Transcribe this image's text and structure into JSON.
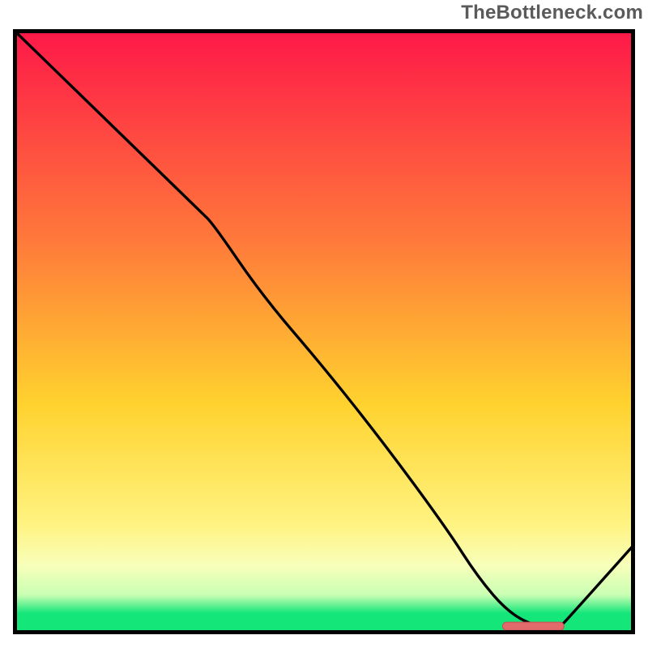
{
  "attribution": "TheBottleneck.com",
  "colors": {
    "frame": "#020202",
    "curve": "#020202",
    "marker_fill": "#e26a6a",
    "marker_stroke": "#c94f4f",
    "top": "#fe1948",
    "mid1": "#ff7a3a",
    "mid2": "#ffd22e",
    "low1": "#fff380",
    "low2": "#f8ffba",
    "low3": "#c9ffb3",
    "bottom": "#15e67a"
  },
  "chart_data": {
    "type": "line",
    "title": "",
    "xlabel": "",
    "ylabel": "",
    "xlim": [
      0,
      100
    ],
    "ylim": [
      0,
      100
    ],
    "x": [
      0,
      10,
      20,
      30,
      32,
      40,
      50,
      60,
      70,
      75,
      80,
      85,
      88,
      90,
      100
    ],
    "values": [
      100,
      90,
      80,
      70,
      68,
      56,
      44,
      31,
      17,
      9,
      3,
      0.5,
      0.3,
      2.5,
      14
    ],
    "marker": {
      "x_center": 84,
      "half_width": 5,
      "y": 0.8
    },
    "gradient_stops": [
      {
        "offset": 0.0,
        "color_key": "top"
      },
      {
        "offset": 0.35,
        "color_key": "mid1"
      },
      {
        "offset": 0.62,
        "color_key": "mid2"
      },
      {
        "offset": 0.82,
        "color_key": "low1"
      },
      {
        "offset": 0.89,
        "color_key": "low2"
      },
      {
        "offset": 0.94,
        "color_key": "low3"
      },
      {
        "offset": 0.97,
        "color_key": "bottom"
      },
      {
        "offset": 1.0,
        "color_key": "bottom"
      }
    ]
  }
}
